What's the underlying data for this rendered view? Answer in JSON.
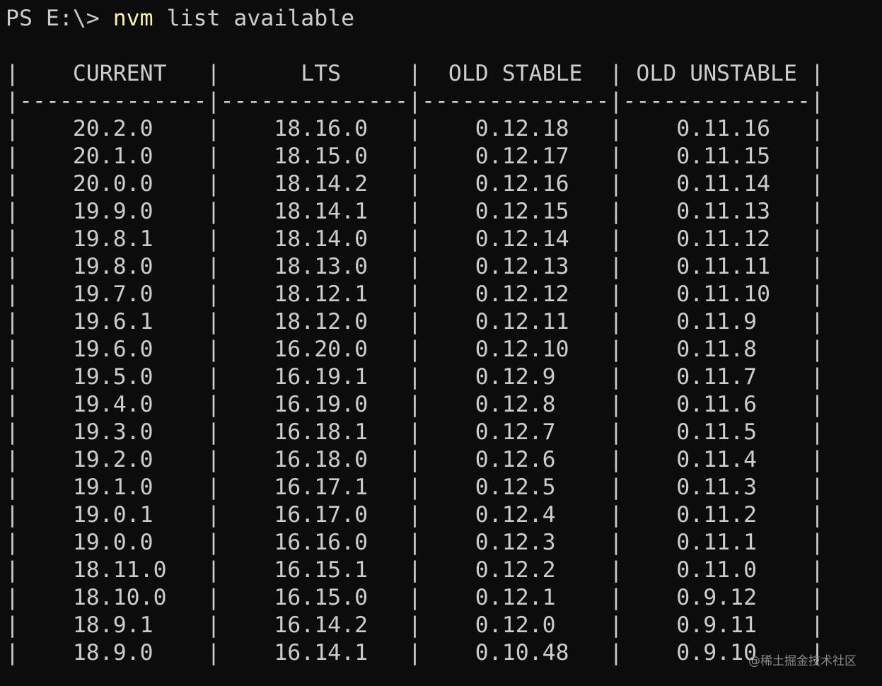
{
  "terminal": {
    "prompt": "PS E:\\> ",
    "command": "nvm",
    "args": " list available"
  },
  "table": {
    "headers": [
      "CURRENT",
      "LTS",
      "OLD STABLE",
      "OLD UNSTABLE"
    ],
    "separator": "--------------",
    "rows": [
      [
        "20.2.0",
        "18.16.0",
        "0.12.18",
        "0.11.16"
      ],
      [
        "20.1.0",
        "18.15.0",
        "0.12.17",
        "0.11.15"
      ],
      [
        "20.0.0",
        "18.14.2",
        "0.12.16",
        "0.11.14"
      ],
      [
        "19.9.0",
        "18.14.1",
        "0.12.15",
        "0.11.13"
      ],
      [
        "19.8.1",
        "18.14.0",
        "0.12.14",
        "0.11.12"
      ],
      [
        "19.8.0",
        "18.13.0",
        "0.12.13",
        "0.11.11"
      ],
      [
        "19.7.0",
        "18.12.1",
        "0.12.12",
        "0.11.10"
      ],
      [
        "19.6.1",
        "18.12.0",
        "0.12.11",
        "0.11.9"
      ],
      [
        "19.6.0",
        "16.20.0",
        "0.12.10",
        "0.11.8"
      ],
      [
        "19.5.0",
        "16.19.1",
        "0.12.9",
        "0.11.7"
      ],
      [
        "19.4.0",
        "16.19.0",
        "0.12.8",
        "0.11.6"
      ],
      [
        "19.3.0",
        "16.18.1",
        "0.12.7",
        "0.11.5"
      ],
      [
        "19.2.0",
        "16.18.0",
        "0.12.6",
        "0.11.4"
      ],
      [
        "19.1.0",
        "16.17.1",
        "0.12.5",
        "0.11.3"
      ],
      [
        "19.0.1",
        "16.17.0",
        "0.12.4",
        "0.11.2"
      ],
      [
        "19.0.0",
        "16.16.0",
        "0.12.3",
        "0.11.1"
      ],
      [
        "18.11.0",
        "16.15.1",
        "0.12.2",
        "0.11.0"
      ],
      [
        "18.10.0",
        "16.15.0",
        "0.12.1",
        "0.9.12"
      ],
      [
        "18.9.1",
        "16.14.2",
        "0.12.0",
        "0.9.11"
      ],
      [
        "18.9.0",
        "16.14.1",
        "0.10.48",
        "0.9.10"
      ]
    ]
  },
  "watermark": "@稀土掘金技术社区",
  "colors": {
    "background": "#0c0c0c",
    "text": "#cccccc",
    "command": "#f9f1a5"
  }
}
